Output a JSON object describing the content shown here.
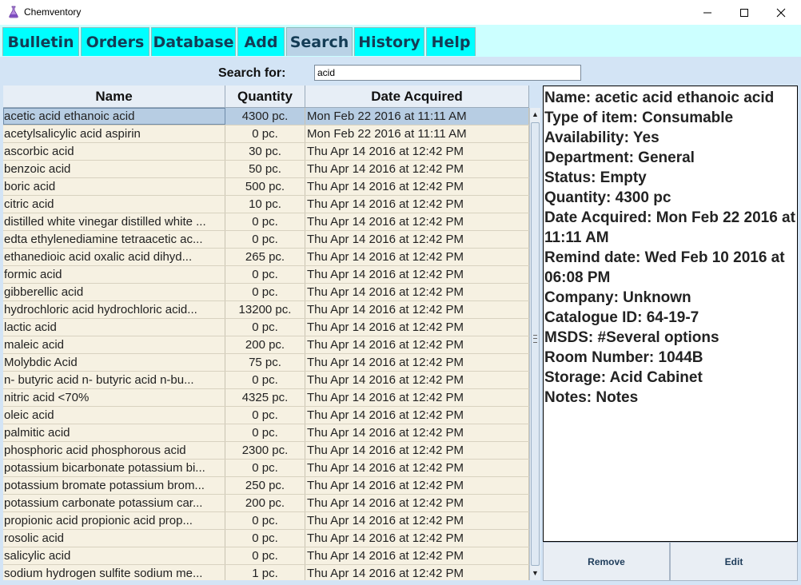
{
  "window": {
    "title": "Chemventory",
    "icon": "flask-icon",
    "controls": {
      "minimize": "—",
      "maximize": "☐",
      "close": "✕"
    }
  },
  "tabs": [
    {
      "label": "Bulletin",
      "active": false
    },
    {
      "label": "Orders",
      "active": false
    },
    {
      "label": "Database",
      "active": false
    },
    {
      "label": "Add",
      "active": false
    },
    {
      "label": "Search",
      "active": true
    },
    {
      "label": "History",
      "active": false
    },
    {
      "label": "Help",
      "active": false
    }
  ],
  "search": {
    "label": "Search for:",
    "value": "acid"
  },
  "table": {
    "columns": [
      "Name",
      "Quantity",
      "Date Acquired"
    ],
    "rows": [
      {
        "name": "acetic acid ethanoic acid",
        "quantity": "4300 pc.",
        "date": "Mon Feb 22 2016 at 11:11 AM",
        "selected": true
      },
      {
        "name": "acetylsalicylic acid aspirin",
        "quantity": "0 pc.",
        "date": "Mon Feb 22 2016 at 11:11 AM"
      },
      {
        "name": "ascorbic acid",
        "quantity": "30 pc.",
        "date": "Thu Apr 14 2016 at 12:42 PM"
      },
      {
        "name": "benzoic acid",
        "quantity": "50 pc.",
        "date": "Thu Apr 14 2016 at 12:42 PM"
      },
      {
        "name": "boric acid",
        "quantity": "500 pc.",
        "date": "Thu Apr 14 2016 at 12:42 PM"
      },
      {
        "name": "citric acid",
        "quantity": "10 pc.",
        "date": "Thu Apr 14 2016 at 12:42 PM"
      },
      {
        "name": "distilled white vinegar distilled white ...",
        "quantity": "0 pc.",
        "date": "Thu Apr 14 2016 at 12:42 PM"
      },
      {
        "name": "edta ethylenediamine tetraacetic ac...",
        "quantity": "0 pc.",
        "date": "Thu Apr 14 2016 at 12:42 PM"
      },
      {
        "name": "ethanedioic acid   oxalic acid dihyd...",
        "quantity": "265 pc.",
        "date": "Thu Apr 14 2016 at 12:42 PM"
      },
      {
        "name": "formic acid",
        "quantity": "0 pc.",
        "date": "Thu Apr 14 2016 at 12:42 PM"
      },
      {
        "name": "gibberellic acid",
        "quantity": "0 pc.",
        "date": "Thu Apr 14 2016 at 12:42 PM"
      },
      {
        "name": "hydrochloric acid hydrochloric acid...",
        "quantity": "13200 pc.",
        "date": "Thu Apr 14 2016 at 12:42 PM"
      },
      {
        "name": "lactic acid",
        "quantity": "0 pc.",
        "date": "Thu Apr 14 2016 at 12:42 PM"
      },
      {
        "name": "maleic acid",
        "quantity": "200 pc.",
        "date": "Thu Apr 14 2016 at 12:42 PM"
      },
      {
        "name": "Molybdic Acid",
        "quantity": "75 pc.",
        "date": "Thu Apr 14 2016 at 12:42 PM"
      },
      {
        "name": "n- butyric acid n- butyric acid  n-bu...",
        "quantity": "0 pc.",
        "date": "Thu Apr 14 2016 at 12:42 PM"
      },
      {
        "name": "nitric acid <70%",
        "quantity": "4325 pc.",
        "date": "Thu Apr 14 2016 at 12:42 PM"
      },
      {
        "name": "oleic acid",
        "quantity": "0 pc.",
        "date": "Thu Apr 14 2016 at 12:42 PM"
      },
      {
        "name": "palmitic acid",
        "quantity": "0 pc.",
        "date": "Thu Apr 14 2016 at 12:42 PM"
      },
      {
        "name": "phosphoric acid phosphorous acid",
        "quantity": "2300 pc.",
        "date": "Thu Apr 14 2016 at 12:42 PM"
      },
      {
        "name": "potassium bicarbonate potassium bi...",
        "quantity": "0 pc.",
        "date": "Thu Apr 14 2016 at 12:42 PM"
      },
      {
        "name": "potassium bromate potassium brom...",
        "quantity": "250 pc.",
        "date": "Thu Apr 14 2016 at 12:42 PM"
      },
      {
        "name": "potassium carbonate potassium car...",
        "quantity": "200 pc.",
        "date": "Thu Apr 14 2016 at 12:42 PM"
      },
      {
        "name": "propionic acid propionic acid  prop...",
        "quantity": "0 pc.",
        "date": "Thu Apr 14 2016 at 12:42 PM"
      },
      {
        "name": "rosolic acid",
        "quantity": "0 pc.",
        "date": "Thu Apr 14 2016 at 12:42 PM"
      },
      {
        "name": "salicylic acid",
        "quantity": "0 pc.",
        "date": "Thu Apr 14 2016 at 12:42 PM"
      },
      {
        "name": "sodium hydrogen sulfite sodium me...",
        "quantity": "1 pc.",
        "date": "Thu Apr 14 2016 at 12:42 PM"
      }
    ]
  },
  "details": {
    "lines": [
      "Name: acetic acid ethanoic acid",
      "Type of item: Consumable",
      "Availability: Yes",
      "Department: General",
      "Status: Empty",
      "Quantity: 4300 pc",
      "Date Acquired: Mon Feb 22 2016 at 11:11 AM",
      "Remind date: Wed Feb 10 2016 at 06:08 PM",
      "Company: Unknown",
      "Catalogue ID: 64-19-7",
      "MSDS: #Several options",
      "Room Number: 1044B",
      "Storage: Acid Cabinet",
      "Notes: Notes"
    ]
  },
  "buttons": {
    "remove": "Remove",
    "edit": "Edit"
  },
  "scrollbar": {
    "up_icon": "▲",
    "down_icon": "▼"
  },
  "colors": {
    "tab_bg": "#00ffff",
    "tab_active": "#b9d2e6",
    "tab_text": "#143c55",
    "row_bg": "#f6f1e2",
    "row_selected": "#b7cde3"
  }
}
